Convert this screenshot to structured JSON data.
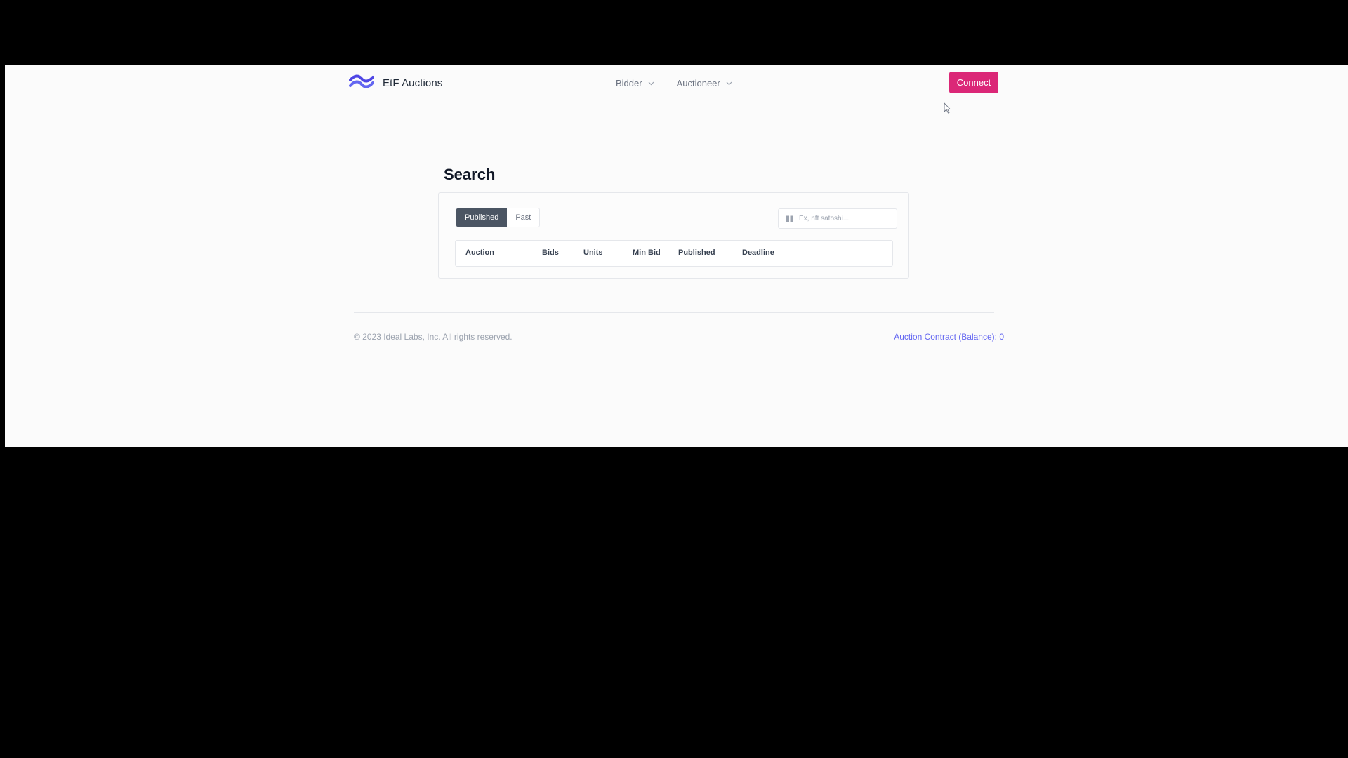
{
  "header": {
    "brand": "EtF Auctions",
    "nav": [
      {
        "label": "Bidder"
      },
      {
        "label": "Auctioneer"
      }
    ],
    "connect_label": "Connect"
  },
  "search": {
    "title": "Search",
    "tabs": [
      {
        "label": "Published",
        "active": true
      },
      {
        "label": "Past",
        "active": false
      }
    ],
    "placeholder": "Ex, nft satoshi..."
  },
  "table": {
    "columns": [
      "Auction",
      "Bids",
      "Units",
      "Min Bid",
      "Published",
      "Deadline"
    ]
  },
  "footer": {
    "copyright": "© 2023 Ideal Labs, Inc. All rights reserved.",
    "contract_label": "Auction Contract (Balance): ",
    "contract_balance": "0"
  },
  "colors": {
    "background": "#fbfbfb",
    "accent": "#db2777",
    "active_tab": "#4b5563",
    "link": "#6366f1",
    "logo": "#4f46e5"
  },
  "icons": {
    "logo": "wave-logo-icon",
    "dropdown": "chevron-down-icon",
    "search": "search-icon",
    "cursor": "mouse-cursor-icon"
  }
}
